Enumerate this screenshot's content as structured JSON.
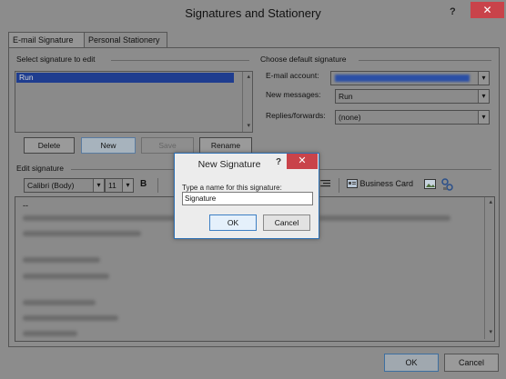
{
  "window": {
    "title": "Signatures and Stationery",
    "help": "?",
    "close": "✕"
  },
  "tabs": [
    {
      "label": "E-mail Signature"
    },
    {
      "label": "Personal Stationery"
    }
  ],
  "left": {
    "select_heading": "Select signature to edit",
    "signatures": [
      "Run"
    ],
    "buttons": {
      "delete": "Delete",
      "new": "New",
      "save": "Save",
      "rename": "Rename"
    }
  },
  "right": {
    "heading": "Choose default signature",
    "email_account_label": "E-mail account:",
    "new_messages_label": "New messages:",
    "new_messages_value": "Run",
    "replies_label": "Replies/forwards:",
    "replies_value": "(none)"
  },
  "edit": {
    "heading": "Edit signature",
    "font": "Calibri (Body)",
    "size": "11",
    "bold": "B",
    "business_card": "Business Card",
    "first_line": "--"
  },
  "dialog": {
    "title": "New Signature",
    "help": "?",
    "close": "✕",
    "prompt": "Type a name for this signature:",
    "value": "Signature",
    "ok": "OK",
    "cancel": "Cancel"
  },
  "footer": {
    "ok": "OK",
    "cancel": "Cancel"
  },
  "icons": {
    "dropdown": "▾",
    "scroll_up": "▴",
    "scroll_down": "▾"
  }
}
